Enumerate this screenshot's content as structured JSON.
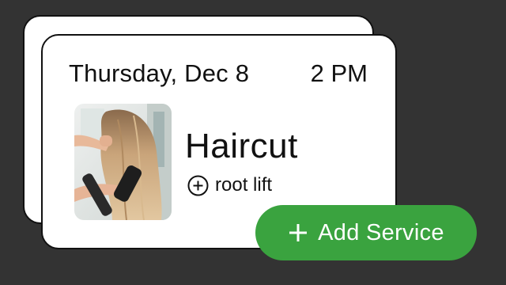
{
  "appointment": {
    "date": "Thursday, Dec 8",
    "time": "2 PM",
    "service": "Haircut",
    "addon": "root lift",
    "photo_subject": "hair styling photo"
  },
  "actions": {
    "add_service_label": "Add Service"
  },
  "icons": {
    "addon": "plus-circle-icon",
    "add_button": "plus-icon"
  },
  "colors": {
    "background": "#333333",
    "card": "#ffffff",
    "accent": "#3aa33f",
    "text": "#111111"
  }
}
